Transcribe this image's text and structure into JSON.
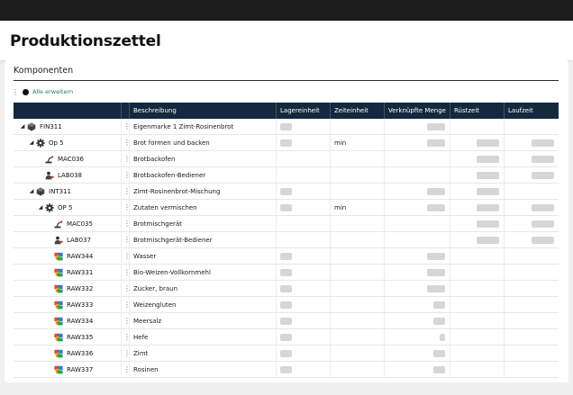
{
  "page": {
    "title": "Produktionszettel"
  },
  "section": {
    "title": "Komponenten",
    "expand_all_label": "Alle erweitern"
  },
  "table": {
    "columns": [
      "Beschreibung",
      "Lagereinheit",
      "Zeiteinheit",
      "Verknüpfte Menge",
      "Rüstzeit",
      "Laufzeit"
    ],
    "rows": [
      {
        "code": "FIN311",
        "level": 0,
        "toggle": "◢",
        "icon": "product-cube-icon",
        "description": "Eigenmarke 1 Zimt-Rosinenbrot",
        "lager": true,
        "zeit": "",
        "verk": 1.0,
        "rust": false,
        "lauf": false
      },
      {
        "code": "Op 5",
        "level": 1,
        "toggle": "◢",
        "icon": "operation-gear-icon",
        "description": "Brot formen und backen",
        "lager": true,
        "zeit": "min",
        "verk": 1.0,
        "rust": true,
        "lauf": true
      },
      {
        "code": "MAC036",
        "level": 2,
        "toggle": "",
        "icon": "machine-icon",
        "description": "Brotbackofen",
        "lager": false,
        "zeit": "",
        "verk": 0,
        "rust": true,
        "lauf": true
      },
      {
        "code": "LAB038",
        "level": 2,
        "toggle": "",
        "icon": "labor-worker-icon",
        "description": "Brotbackofen-Bediener",
        "lager": false,
        "zeit": "",
        "verk": 0,
        "rust": true,
        "lauf": true
      },
      {
        "code": "INT311",
        "level": 1,
        "toggle": "◢",
        "icon": "product-cube-icon",
        "description": "Zimt-Rosinenbrot-Mischung",
        "lager": true,
        "zeit": "",
        "verk": 1.0,
        "rust": true,
        "lauf": false
      },
      {
        "code": "OP 5",
        "level": 2,
        "toggle": "◢",
        "icon": "operation-gear-icon",
        "description": "Zutaten vermischen",
        "lager": true,
        "zeit": "min",
        "verk": 1.0,
        "rust": true,
        "lauf": true
      },
      {
        "code": "MAC035",
        "level": 3,
        "toggle": "",
        "icon": "machine-icon",
        "description": "Brotmischgerät",
        "lager": false,
        "zeit": "",
        "verk": 0,
        "rust": true,
        "lauf": true
      },
      {
        "code": "LAB037",
        "level": 3,
        "toggle": "",
        "icon": "labor-worker-icon",
        "description": "Brotmischgerät-Bediener",
        "lager": false,
        "zeit": "",
        "verk": 0,
        "rust": true,
        "lauf": true
      },
      {
        "code": "RAW344",
        "level": 3,
        "toggle": "",
        "icon": "raw-material-icon",
        "description": "Wasser",
        "lager": true,
        "zeit": "",
        "verk": 1.0,
        "rust": false,
        "lauf": false
      },
      {
        "code": "RAW331",
        "level": 3,
        "toggle": "",
        "icon": "raw-material-icon",
        "description": "Bio-Weizen-Vollkornmehl",
        "lager": true,
        "zeit": "",
        "verk": 1.0,
        "rust": false,
        "lauf": false
      },
      {
        "code": "RAW332",
        "level": 3,
        "toggle": "",
        "icon": "raw-material-icon",
        "description": "Zucker, braun",
        "lager": true,
        "zeit": "",
        "verk": 1.0,
        "rust": false,
        "lauf": false
      },
      {
        "code": "RAW333",
        "level": 3,
        "toggle": "",
        "icon": "raw-material-icon",
        "description": "Weizengluten",
        "lager": true,
        "zeit": "",
        "verk": 0.65,
        "rust": false,
        "lauf": false
      },
      {
        "code": "RAW334",
        "level": 3,
        "toggle": "",
        "icon": "raw-material-icon",
        "description": "Meersalz",
        "lager": true,
        "zeit": "",
        "verk": 0.65,
        "rust": false,
        "lauf": false
      },
      {
        "code": "RAW335",
        "level": 3,
        "toggle": "",
        "icon": "raw-material-icon",
        "description": "Hefe",
        "lager": true,
        "zeit": "",
        "verk": 0.3,
        "rust": false,
        "lauf": false
      },
      {
        "code": "RAW336",
        "level": 3,
        "toggle": "",
        "icon": "raw-material-icon",
        "description": "Zimt",
        "lager": true,
        "zeit": "",
        "verk": 0.65,
        "rust": false,
        "lauf": false
      },
      {
        "code": "RAW337",
        "level": 3,
        "toggle": "",
        "icon": "raw-material-icon",
        "description": "Rosinen",
        "lager": true,
        "zeit": "",
        "verk": 0.65,
        "rust": false,
        "lauf": false
      }
    ]
  }
}
